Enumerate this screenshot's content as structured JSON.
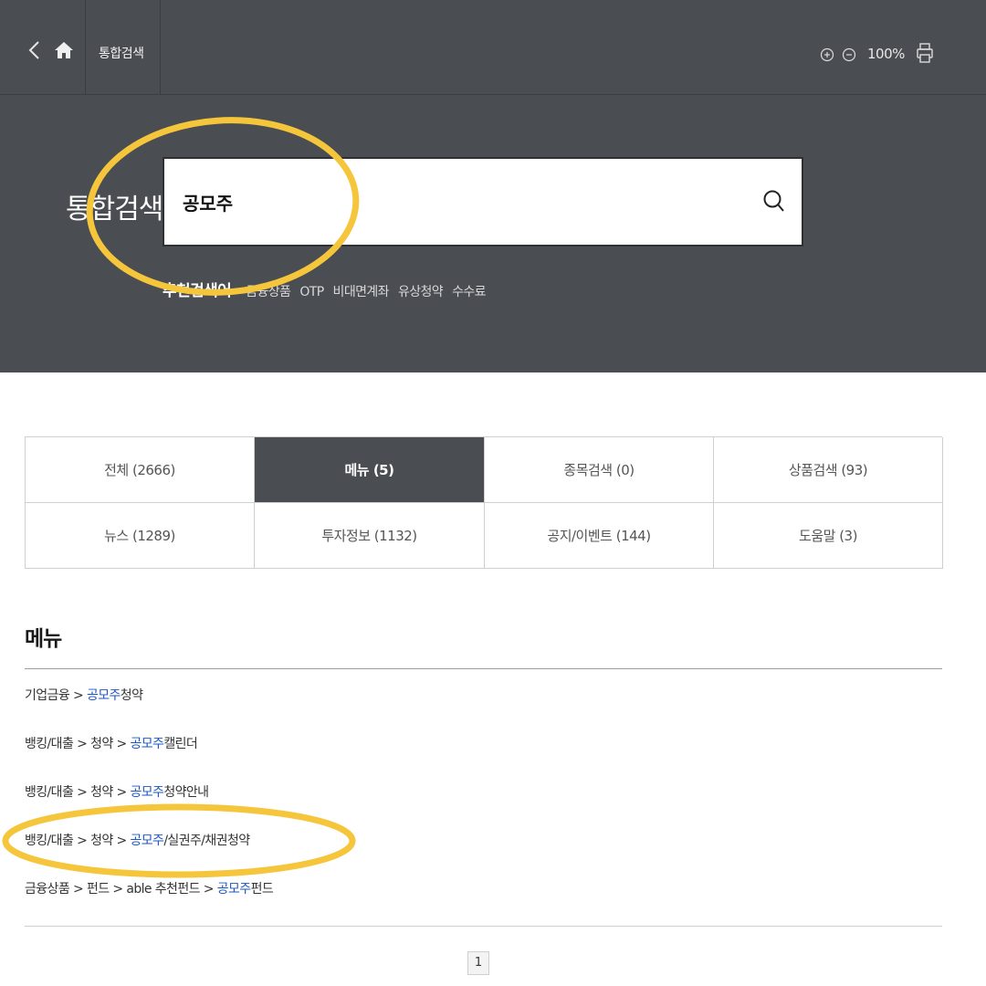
{
  "topbar": {
    "title": "통합검색",
    "zoom_level": "100%",
    "icons": [
      "back-chevron-icon",
      "home-icon",
      "zoom-in-icon",
      "zoom-out-icon",
      "print-icon"
    ]
  },
  "hero": {
    "label": "통합검색",
    "search_value": "공모주",
    "recommended_title": "추천검색어",
    "recommended_keywords": [
      "금융상품",
      "OTP",
      "비대면계좌",
      "유상청약",
      "수수료"
    ]
  },
  "tabs": [
    {
      "label": "전체 (2666)",
      "active": false
    },
    {
      "label": "메뉴 (5)",
      "active": true
    },
    {
      "label": "종목검색 (0)",
      "active": false
    },
    {
      "label": "상품검색 (93)",
      "active": false
    },
    {
      "label": "뉴스 (1289)",
      "active": false
    },
    {
      "label": "투자정보 (1132)",
      "active": false
    },
    {
      "label": "공지/이벤트 (144)",
      "active": false
    },
    {
      "label": "도움말 (3)",
      "active": false
    }
  ],
  "menu_section": {
    "title": "메뉴",
    "results": [
      {
        "prefix": "기업금융 > ",
        "highlight": "공모주",
        "suffix": "청약"
      },
      {
        "prefix": "뱅킹/대출 > 청약 > ",
        "highlight": "공모주",
        "suffix": "캘린더"
      },
      {
        "prefix": "뱅킹/대출 > 청약 > ",
        "highlight": "공모주",
        "suffix": "청약안내"
      },
      {
        "prefix": "뱅킹/대출 > 청약 > ",
        "highlight": "공모주",
        "suffix": "/실권주/채권청약"
      },
      {
        "prefix": "금융상품 > 펀드 > able 추천펀드 > ",
        "highlight": "공모주",
        "suffix": "펀드"
      }
    ]
  },
  "pagination": {
    "current_page": "1"
  },
  "colors": {
    "header_bg": "#4a4d52",
    "highlight_text": "#1a56c4",
    "annotation": "#f5c63c"
  }
}
